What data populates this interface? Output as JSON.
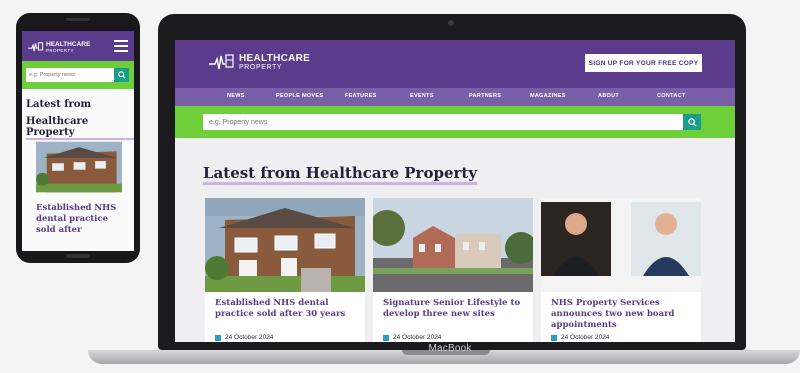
{
  "site": {
    "logo_line1": "HEALTHCARE",
    "logo_line2": "PROPERTY",
    "signup_label": "SIGN UP FOR YOUR FREE COPY",
    "nav": [
      "NEWS",
      "PEOPLE MOVES",
      "FEATURES",
      "EVENTS",
      "PARTNERS",
      "MAGAZINES",
      "ABOUT",
      "CONTACT"
    ],
    "search_placeholder": "e.g. Property news",
    "latest_heading": "Latest from Healthcare Property",
    "cards": [
      {
        "title": "Established NHS dental practice sold after 30 years",
        "date": "24 October 2024"
      },
      {
        "title": "Signature Senior Lifestyle to develop three new sites",
        "date": "24 October 2024"
      },
      {
        "title": "NHS Property Services announces two new board appointments",
        "date": "24 October 2024"
      }
    ]
  },
  "phone": {
    "heading_line1": "Latest from",
    "heading_line2": "Healthcare Property",
    "card_title": "Established NHS dental practice sold after"
  },
  "device": {
    "laptop_brand": "MacBook"
  },
  "colors": {
    "primary": "#5b3b8c",
    "nav": "#7a5ea8",
    "accent_green": "#6fcf3a",
    "teal": "#1c9c8a"
  }
}
